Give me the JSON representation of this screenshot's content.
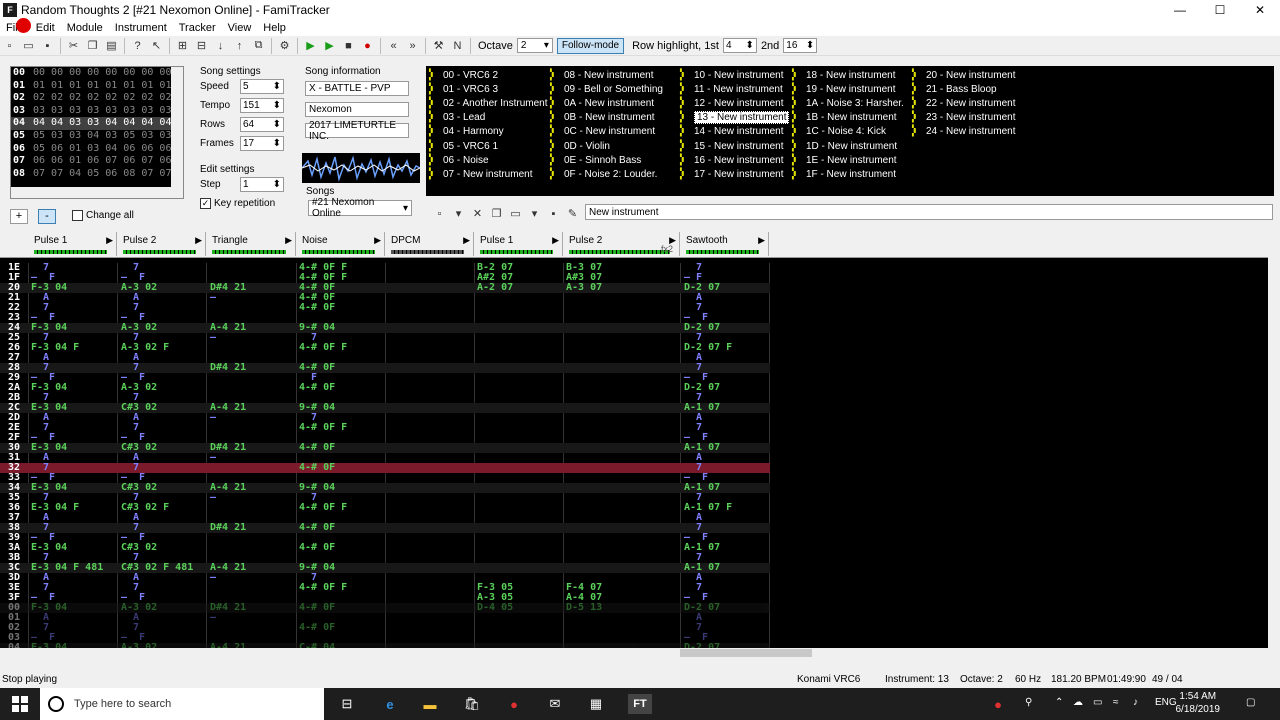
{
  "window": {
    "title": "Random Thoughts 2 [#21 Nexomon Online] - FamiTracker",
    "app_icon": "ft-icon",
    "controls": [
      "minimize",
      "maximize",
      "close"
    ]
  },
  "menu": [
    "File",
    "Edit",
    "Module",
    "Instrument",
    "Tracker",
    "View",
    "Help"
  ],
  "toolbar": {
    "octave_label": "Octave",
    "octave_value": "2",
    "follow_mode": "Follow-mode",
    "row_highlight_label": "Row highlight, 1st",
    "row_highlight_1st": "4",
    "second_label": "2nd",
    "row_highlight_2nd": "16"
  },
  "frames": {
    "rows": [
      {
        "n": "00",
        "v": "00 00 00 00 00 00 00 00"
      },
      {
        "n": "01",
        "v": "01 01 01 01 01 01 01 01"
      },
      {
        "n": "02",
        "v": "02 02 02 02 02 02 02 02"
      },
      {
        "n": "03",
        "v": "03 03 03 03 03 03 03 03"
      },
      {
        "n": "04",
        "v": "04 04 03 03 04 04 04 04"
      },
      {
        "n": "05",
        "v": "05 03 03 04 03 05 03 03"
      },
      {
        "n": "06",
        "v": "05 06 01 03 04 06 06 06"
      },
      {
        "n": "07",
        "v": "06 06 01 06 07 06 07 06"
      },
      {
        "n": "08",
        "v": "07 07 04 05 06 08 07 07"
      }
    ],
    "selected_index": 4,
    "add_label": "+",
    "remove_label": "-",
    "change_all": "Change all"
  },
  "song_settings": {
    "title": "Song settings",
    "speed_label": "Speed",
    "speed": "5",
    "tempo_label": "Tempo",
    "tempo": "151",
    "rows_label": "Rows",
    "rows": "64",
    "frames_label": "Frames",
    "frames": "17"
  },
  "edit_settings": {
    "title": "Edit settings",
    "step_label": "Step",
    "step": "1",
    "key_repetition": "Key repetition"
  },
  "song_info": {
    "title": "Song information",
    "name": "X - BATTLE - PVP",
    "artist": "Nexomon",
    "copyright": "2017 LIMETURTLE INC.",
    "songs_label": "Songs",
    "song_selected": "#21 Nexomon Online"
  },
  "instruments": {
    "columns": [
      [
        "00 - VRC6 2",
        "01 - VRC6 3",
        "02 - Another Instrument",
        "03 - Lead",
        "04 - Harmony",
        "05 - VRC6 1",
        "06 - Noise",
        "07 - New instrument"
      ],
      [
        "08 - New instrument",
        "09 - Bell or Something",
        "0A - New instrument",
        "0B - New instrument",
        "0C - New instrument",
        "0D - Violin",
        "0E - Sinnoh Bass",
        "0F - Noise 2: Louder."
      ],
      [
        "10 - New instrument",
        "11 - New instrument",
        "12 - New instrument",
        "13 - New instrument",
        "14 - New instrument",
        "15 - New instrument",
        "16 - New instrument",
        "17 - New instrument"
      ],
      [
        "18 - New instrument",
        "19 - New instrument",
        "1A - Noise 3: Harsher.",
        "1B - New instrument",
        "1C - Noise 4: Kick",
        "1D - New instrument",
        "1E - New instrument",
        "1F - New instrument"
      ],
      [
        "20 - New instrument",
        "21 - Bass Bloop",
        "22 - New instrument",
        "23 - New instrument",
        "24 - New instrument"
      ]
    ],
    "selected": "13 - New instrument",
    "name_field": "New instrument"
  },
  "channels": [
    {
      "name": "Pulse 1"
    },
    {
      "name": "Pulse 2"
    },
    {
      "name": "Triangle"
    },
    {
      "name": "Noise"
    },
    {
      "name": "DPCM"
    },
    {
      "name": "Pulse 1"
    },
    {
      "name": "Pulse 2"
    },
    {
      "name": "Sawtooth"
    }
  ],
  "fx_label": "fx2",
  "pattern_rows": [
    {
      "r": "1E",
      "c": [
        "  7",
        "  7",
        "",
        "4-# 0F F",
        "",
        "B-2 07",
        "B-3 07",
        "  7"
      ]
    },
    {
      "r": "1F",
      "c": [
        "—  F",
        "—  F",
        "",
        "4-# 0F F",
        "",
        "A#2 07",
        "A#3 07",
        "— F"
      ]
    },
    {
      "r": "20",
      "c": [
        "F-3 04",
        "A-3 02",
        "D#4 21",
        "4-# 0F",
        "",
        "A-2 07",
        "A-3 07",
        "D-2 07"
      ]
    },
    {
      "r": "21",
      "c": [
        "  A",
        "  A",
        "—",
        "4-# 0F",
        "",
        "",
        "",
        "  A"
      ]
    },
    {
      "r": "22",
      "c": [
        "  7",
        "  7",
        "",
        "4-# 0F",
        "",
        "",
        "",
        "  7"
      ]
    },
    {
      "r": "23",
      "c": [
        "—  F",
        "—  F",
        "",
        "",
        "",
        "",
        "",
        "—  F"
      ]
    },
    {
      "r": "24",
      "c": [
        "F-3 04",
        "A-3 02",
        "A-4 21",
        "9-# 04",
        "",
        "",
        "",
        "D-2 07"
      ]
    },
    {
      "r": "25",
      "c": [
        "  7",
        "  7",
        "—",
        "  7",
        "",
        "",
        "",
        "  7"
      ]
    },
    {
      "r": "26",
      "c": [
        "F-3 04 F",
        "A-3 02 F",
        "",
        "4-# 0F F",
        "",
        "",
        "",
        "D-2 07 F"
      ]
    },
    {
      "r": "27",
      "c": [
        "  A",
        "  A",
        "",
        "",
        "",
        "",
        "",
        "  A"
      ]
    },
    {
      "r": "28",
      "c": [
        "  7",
        "  7",
        "D#4 21",
        "4-# 0F",
        "",
        "",
        "",
        "  7"
      ]
    },
    {
      "r": "29",
      "c": [
        "—  F",
        "—  F",
        "",
        "  F",
        "",
        "",
        "",
        "—  F"
      ]
    },
    {
      "r": "2A",
      "c": [
        "F-3 04",
        "A-3 02",
        "",
        "4-# 0F",
        "",
        "",
        "",
        "D-2 07"
      ]
    },
    {
      "r": "2B",
      "c": [
        "  7",
        "  7",
        "",
        "",
        "",
        "",
        "",
        "  7"
      ]
    },
    {
      "r": "2C",
      "c": [
        "E-3 04",
        "C#3 02",
        "A-4 21",
        "9-# 04",
        "",
        "",
        "",
        "A-1 07"
      ]
    },
    {
      "r": "2D",
      "c": [
        "  A",
        "  A",
        "—",
        "  7",
        "",
        "",
        "",
        "  A"
      ]
    },
    {
      "r": "2E",
      "c": [
        "  7",
        "  7",
        "",
        "4-# 0F F",
        "",
        "",
        "",
        "  7"
      ]
    },
    {
      "r": "2F",
      "c": [
        "—  F",
        "—  F",
        "",
        "",
        "",
        "",
        "",
        "—  F"
      ]
    },
    {
      "r": "30",
      "c": [
        "E-3 04",
        "C#3 02",
        "D#4 21",
        "4-# 0F",
        "",
        "",
        "",
        "A-1 07"
      ]
    },
    {
      "r": "31",
      "c": [
        "  A",
        "  A",
        "—",
        "",
        "",
        "",
        "",
        "  A"
      ]
    },
    {
      "r": "32",
      "c": [
        "  7",
        "  7",
        "",
        "4-# 0F",
        "",
        "",
        "",
        "  7"
      ]
    },
    {
      "r": "33",
      "c": [
        "—  F",
        "—  F",
        "",
        "",
        "",
        "",
        "",
        "—  F"
      ]
    },
    {
      "r": "34",
      "c": [
        "E-3 04",
        "C#3 02",
        "A-4 21",
        "9-# 04",
        "",
        "",
        "",
        "A-1 07"
      ]
    },
    {
      "r": "35",
      "c": [
        "  7",
        "  7",
        "—",
        "  7",
        "",
        "",
        "",
        "  7"
      ]
    },
    {
      "r": "36",
      "c": [
        "E-3 04 F",
        "C#3 02 F",
        "",
        "4-# 0F F",
        "",
        "",
        "",
        "A-1 07 F"
      ]
    },
    {
      "r": "37",
      "c": [
        "  A",
        "  A",
        "",
        "",
        "",
        "",
        "",
        "  A"
      ]
    },
    {
      "r": "38",
      "c": [
        "  7",
        "  7",
        "D#4 21",
        "4-# 0F",
        "",
        "",
        "",
        "  7"
      ]
    },
    {
      "r": "39",
      "c": [
        "—  F",
        "—  F",
        "",
        "",
        "",
        "",
        "",
        "—  F"
      ]
    },
    {
      "r": "3A",
      "c": [
        "E-3 04",
        "C#3 02",
        "",
        "4-# 0F",
        "",
        "",
        "",
        "A-1 07"
      ]
    },
    {
      "r": "3B",
      "c": [
        "  7",
        "  7",
        "",
        "",
        "",
        "",
        "",
        "  7"
      ]
    },
    {
      "r": "3C",
      "c": [
        "E-3 04 F 481",
        "C#3 02 F 481",
        "A-4 21",
        "9-# 04",
        "",
        "",
        "",
        "A-1 07"
      ]
    },
    {
      "r": "3D",
      "c": [
        "  A",
        "  A",
        "—",
        "  7",
        "",
        "",
        "",
        "  A"
      ]
    },
    {
      "r": "3E",
      "c": [
        "  7",
        "  7",
        "",
        "4-# 0F F",
        "",
        "F-3 05",
        "F-4 07",
        "  7"
      ]
    },
    {
      "r": "3F",
      "c": [
        "—  F",
        "—  F",
        "",
        "",
        "",
        "A-3 05",
        "A-4 07",
        "—  F"
      ]
    },
    {
      "r": "00",
      "c": [
        "F-3 04",
        "A-3 02",
        "D#4 21",
        "4-# 0F",
        "",
        "D-4 05",
        "D-5 13",
        "D-2 07"
      ]
    },
    {
      "r": "01",
      "c": [
        "  A",
        "  A",
        "—",
        "",
        "",
        "",
        "",
        "  A"
      ]
    },
    {
      "r": "02",
      "c": [
        "  7",
        "  7",
        "",
        "4-# 0F",
        "",
        "",
        "",
        "  7"
      ]
    },
    {
      "r": "03",
      "c": [
        "—  F",
        "—  F",
        "",
        "",
        "",
        "",
        "",
        "—  F"
      ]
    },
    {
      "r": "04",
      "c": [
        "F-3 04",
        "A-3 02",
        "A-4 21",
        "C-# 04",
        "",
        "",
        "",
        "D-2 07"
      ]
    }
  ],
  "cursor_row": "32",
  "status": {
    "message": "Stop playing",
    "chip": "Konami VRC6",
    "instrument": "Instrument: 13",
    "octave": "Octave: 2",
    "rate": "60 Hz",
    "bpm": "181.20 BPM",
    "time": "01:49:90",
    "position": "49 / 04"
  },
  "taskbar": {
    "search_placeholder": "Type here to search",
    "language": "ENG",
    "time": "1:54 AM",
    "date": "6/18/2019"
  }
}
